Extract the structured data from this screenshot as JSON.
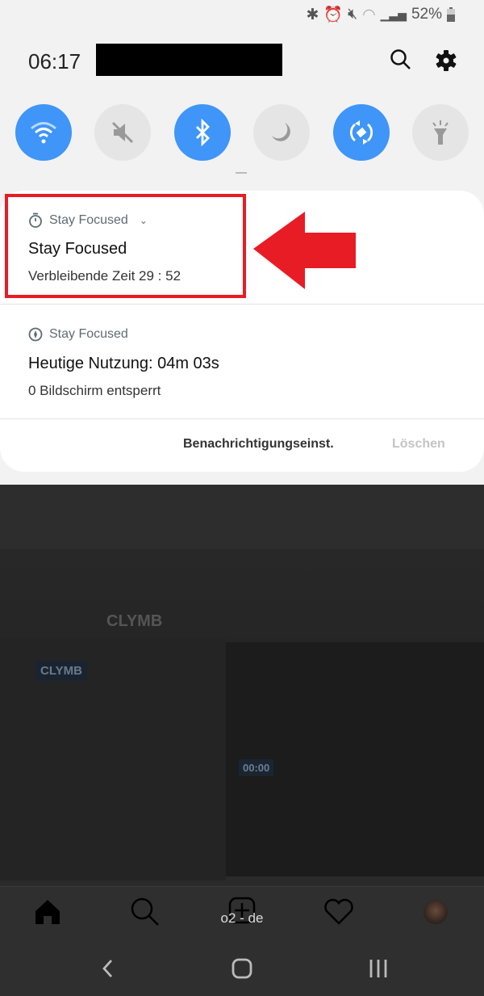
{
  "status_bar": {
    "battery": "52%",
    "icons": [
      "bluetooth-icon",
      "alarm-icon",
      "mute-icon",
      "wifi-icon",
      "signal-icon",
      "battery-icon"
    ]
  },
  "header": {
    "time": "06:17",
    "icons": [
      "search-icon",
      "settings-icon"
    ]
  },
  "quick_tiles": [
    {
      "icon": "wifi-icon",
      "active": true
    },
    {
      "icon": "mute-icon",
      "active": false
    },
    {
      "icon": "bluetooth-icon",
      "active": true
    },
    {
      "icon": "night-mode-icon",
      "active": false
    },
    {
      "icon": "auto-rotate-icon",
      "active": true
    },
    {
      "icon": "flashlight-icon",
      "active": false
    }
  ],
  "notifications": [
    {
      "app": "Stay Focused",
      "title": "Stay Focused",
      "text": "Verbleibende Zeit 29 : 52",
      "icon": "timer-icon"
    },
    {
      "app": "Stay Focused",
      "title": "Heutige Nutzung: 04m 03s",
      "text": "0 Bildschirm entsperrt",
      "icon": "compass-icon"
    }
  ],
  "actions": {
    "settings": "Benachrichtigungseinst.",
    "clear": "Löschen"
  },
  "background": {
    "logo1": "CLYMB",
    "logo2": "CLYMB",
    "timer": "00:00"
  },
  "carrier": "o2 - de",
  "colors": {
    "accent": "#3f95f8",
    "highlight": "#e81c24"
  }
}
